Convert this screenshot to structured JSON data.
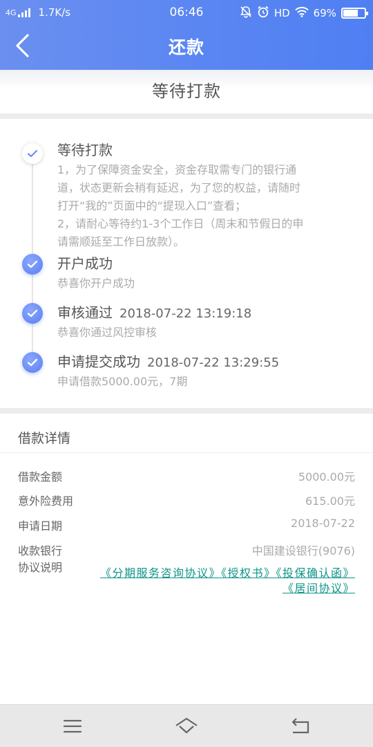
{
  "status_bar": {
    "network": "4G",
    "speed": "1.7K/s",
    "time": "06:46",
    "hd": "HD",
    "battery": "69%",
    "battery_level": 0.69
  },
  "nav": {
    "title": "还款",
    "back_icon": "chevron-left-icon"
  },
  "banner": {
    "title": "等待打款"
  },
  "timeline": {
    "accent_color": "#5b7ef0",
    "steps": [
      {
        "title": "等待打款",
        "time": "",
        "status": "current",
        "desc_lines": [
          "1，为了保障资金安全，资金存取需专门的银行通",
          "道，状态更新会稍有延迟，为了您的权益，请随时",
          "打开“我的”页面中的“提现入口”查看；",
          "2，请耐心等待约1-3个工作日（周末和节假日的申",
          "请需顺延至工作日放款）。"
        ]
      },
      {
        "title": "开户成功",
        "time": "",
        "status": "done",
        "desc_lines": [
          "恭喜你开户成功"
        ]
      },
      {
        "title": "审核通过",
        "time": "2018-07-22 13:19:18",
        "status": "done",
        "desc_lines": [
          "恭喜你通过风控审核"
        ]
      },
      {
        "title": "申请提交成功",
        "time": "2018-07-22 13:29:55",
        "status": "done",
        "desc_lines": [
          "申请借款5000.00元，7期"
        ]
      }
    ]
  },
  "loan_details": {
    "title": "借款详情",
    "rows": [
      {
        "label": "借款金额",
        "value": "5000.00元"
      },
      {
        "label": "意外险费用",
        "value": "615.00元"
      },
      {
        "label": "申请日期",
        "value": "2018-07-22"
      },
      {
        "label": "收款银行",
        "value": "中国建设银行(9076)"
      }
    ],
    "agreement_label": "协议说明",
    "agreement_color": "#0d9488",
    "agreements": [
      "《分期服务咨询协议》",
      "《授权书》",
      "《投保确认函》",
      "《居间协议》"
    ]
  },
  "bottom_nav": {
    "icons": [
      "menu-icon",
      "home-icon",
      "back-icon"
    ]
  }
}
